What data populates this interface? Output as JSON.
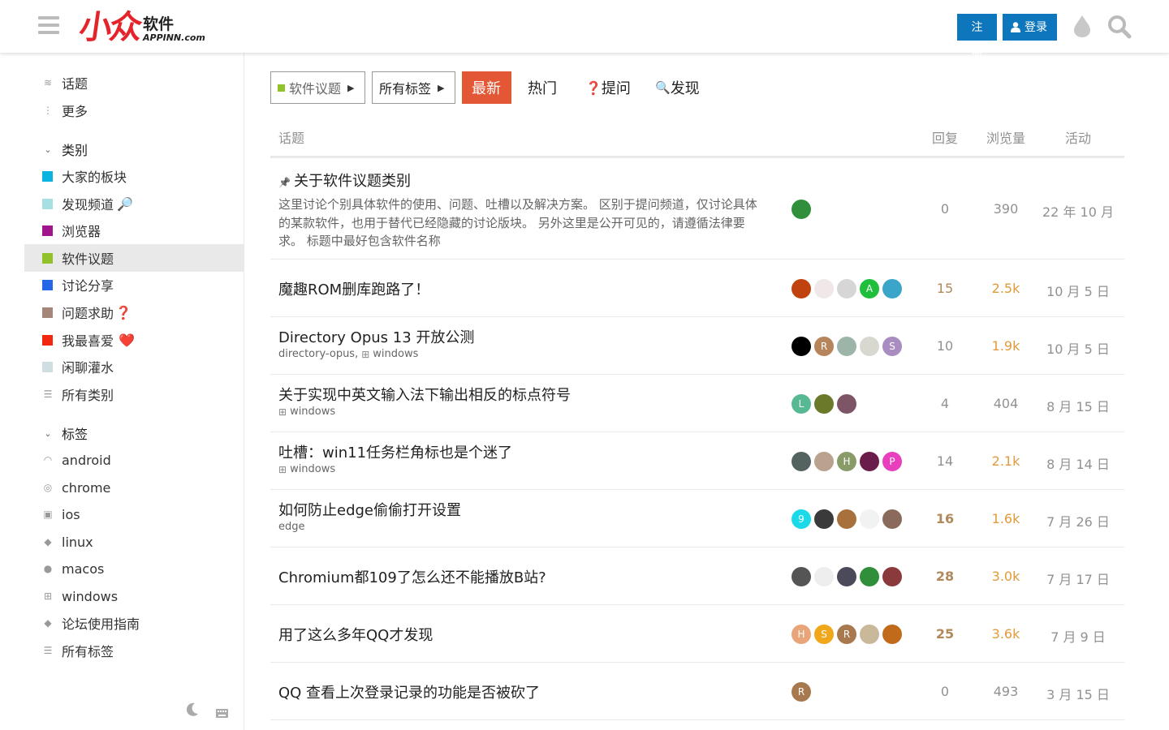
{
  "header": {
    "logo_mark": "小众",
    "logo_cn": "软件",
    "logo_en": "APPINN.com",
    "signup_label": "注册",
    "login_label": "登录",
    "accent": "#0e76bd"
  },
  "sidebar": {
    "top_items": [
      {
        "label": "话题",
        "icon": "layers-icon"
      },
      {
        "label": "更多",
        "icon": "vertical-ellipsis-icon"
      }
    ],
    "categories_heading": "类别",
    "categories": [
      {
        "label": "大家的板块",
        "color": "#0bb3e0",
        "emoji": ""
      },
      {
        "label": "发现频道",
        "color": "#a6e0e0",
        "emoji": "🔎"
      },
      {
        "label": "浏览器",
        "color": "#a0148c",
        "emoji": ""
      },
      {
        "label": "软件议题",
        "color": "#92c22a",
        "emoji": ""
      },
      {
        "label": "讨论分享",
        "color": "#2566e8",
        "emoji": ""
      },
      {
        "label": "问题求助",
        "color": "#a48779",
        "emoji": "❓"
      },
      {
        "label": "我最喜爱",
        "color": "#f1280f",
        "emoji": "❤️"
      },
      {
        "label": "闲聊灌水",
        "color": "#d0dee2",
        "emoji": ""
      },
      {
        "label": "所有类别",
        "color": "",
        "emoji": ""
      }
    ],
    "tags_heading": "标签",
    "tags": [
      {
        "label": "android",
        "icon": "android-icon"
      },
      {
        "label": "chrome",
        "icon": "chrome-icon"
      },
      {
        "label": "ios",
        "icon": "app-store-icon"
      },
      {
        "label": "linux",
        "icon": "tag-icon"
      },
      {
        "label": "macos",
        "icon": "apple-icon"
      },
      {
        "label": "windows",
        "icon": "windows-icon"
      },
      {
        "label": "论坛使用指南",
        "icon": "tag-icon"
      },
      {
        "label": "所有标签",
        "icon": "list-icon"
      }
    ]
  },
  "nav": {
    "category_filter": "软件议题",
    "category_color": "#92c22a",
    "tag_filter": "所有标签",
    "tabs": [
      "最新",
      "热门",
      "提问",
      "发现"
    ],
    "tab_emojis": [
      "",
      "",
      "❓",
      "🔍"
    ]
  },
  "columns": {
    "topic": "话题",
    "replies": "回复",
    "views": "浏览量",
    "activity": "活动"
  },
  "topics": [
    {
      "title": "关于软件议题类别",
      "pinned": true,
      "excerpt": "这里讨论个别具体软件的使用、问题、吐槽以及解决方案。 区别于提问频道，仅讨论具体的某款软件，也用于替代已经隐藏的讨论版块。 另外这里是公开可见的，请遵循法律要求。 标题中最好包含软件名称",
      "tags": [],
      "replies": "0",
      "views": "390",
      "activity": "22 年 10 月",
      "avatars": [
        {
          "letter": "",
          "color": "#2f8f3a"
        }
      ]
    },
    {
      "title": "魔趣ROM删库跑路了！",
      "tags": [],
      "replies": "15",
      "views": "2.5k",
      "activity": "10 月 5 日",
      "avatars": [
        {
          "letter": "",
          "color": "#c0420f"
        },
        {
          "letter": "",
          "color": "#f0e8e8"
        },
        {
          "letter": "",
          "color": "#d6d6d6"
        },
        {
          "letter": "A",
          "color": "#1fbf3c"
        },
        {
          "letter": "",
          "color": "#3aa5c9"
        }
      ]
    },
    {
      "title": "Directory Opus 13 开放公测",
      "tags": [
        "directory-opus",
        "windows"
      ],
      "replies": "10",
      "views": "1.9k",
      "activity": "10 月 5 日",
      "avatars": [
        {
          "letter": "",
          "color": "#000000"
        },
        {
          "letter": "R",
          "color": "#b7855b"
        },
        {
          "letter": "",
          "color": "#9cb5a8"
        },
        {
          "letter": "",
          "color": "#d8d8d0"
        },
        {
          "letter": "S",
          "color": "#a98cc1"
        }
      ]
    },
    {
      "title": "关于实现中英文输入法下输出相反的标点符号",
      "tags": [
        "windows"
      ],
      "replies": "4",
      "views": "404",
      "activity": "8 月 15 日",
      "avatars": [
        {
          "letter": "L",
          "color": "#57b894"
        },
        {
          "letter": "",
          "color": "#6b7a2a"
        },
        {
          "letter": "",
          "color": "#7d5566"
        }
      ]
    },
    {
      "title": "吐槽：win11任务栏角标也是个迷了",
      "tags": [
        "windows"
      ],
      "replies": "14",
      "views": "2.1k",
      "activity": "8 月 14 日",
      "avatars": [
        {
          "letter": "",
          "color": "#556360"
        },
        {
          "letter": "",
          "color": "#b9a38e"
        },
        {
          "letter": "H",
          "color": "#8a9b6a"
        },
        {
          "letter": "",
          "color": "#6a1c4a"
        },
        {
          "letter": "P",
          "color": "#e83fbf"
        }
      ]
    },
    {
      "title": "如何防止edge偷偷打开设置",
      "tags": [
        "edge"
      ],
      "replies": "16",
      "views": "1.6k",
      "activity": "7 月 26 日",
      "avatars": [
        {
          "letter": "9",
          "color": "#1ad9e8"
        },
        {
          "letter": "",
          "color": "#3a3a3a"
        },
        {
          "letter": "",
          "color": "#a8703a"
        },
        {
          "letter": "",
          "color": "#f2f2f2"
        },
        {
          "letter": "",
          "color": "#8a6a5a"
        }
      ]
    },
    {
      "title": "Chromium都109了怎么还不能播放B站?",
      "tags": [],
      "replies": "28",
      "views": "3.0k",
      "activity": "7 月 17 日",
      "avatars": [
        {
          "letter": "",
          "color": "#555555"
        },
        {
          "letter": "",
          "color": "#eeeeee"
        },
        {
          "letter": "",
          "color": "#4a4a5a"
        },
        {
          "letter": "",
          "color": "#2f8f3a"
        },
        {
          "letter": "",
          "color": "#8a3a3a"
        }
      ]
    },
    {
      "title": "用了这么多年QQ才发现",
      "tags": [],
      "replies": "25",
      "views": "3.6k",
      "activity": "7 月 9 日",
      "avatars": [
        {
          "letter": "H",
          "color": "#e8a57a"
        },
        {
          "letter": "S",
          "color": "#f0a81a"
        },
        {
          "letter": "R",
          "color": "#a8784e"
        },
        {
          "letter": "",
          "color": "#c9b89a"
        },
        {
          "letter": "",
          "color": "#c06a1a"
        }
      ]
    },
    {
      "title": "QQ 查看上次登录记录的功能是否被砍了",
      "tags": [],
      "replies": "0",
      "views": "493",
      "activity": "3 月 15 日",
      "avatars": [
        {
          "letter": "R",
          "color": "#a8784e"
        }
      ]
    }
  ]
}
